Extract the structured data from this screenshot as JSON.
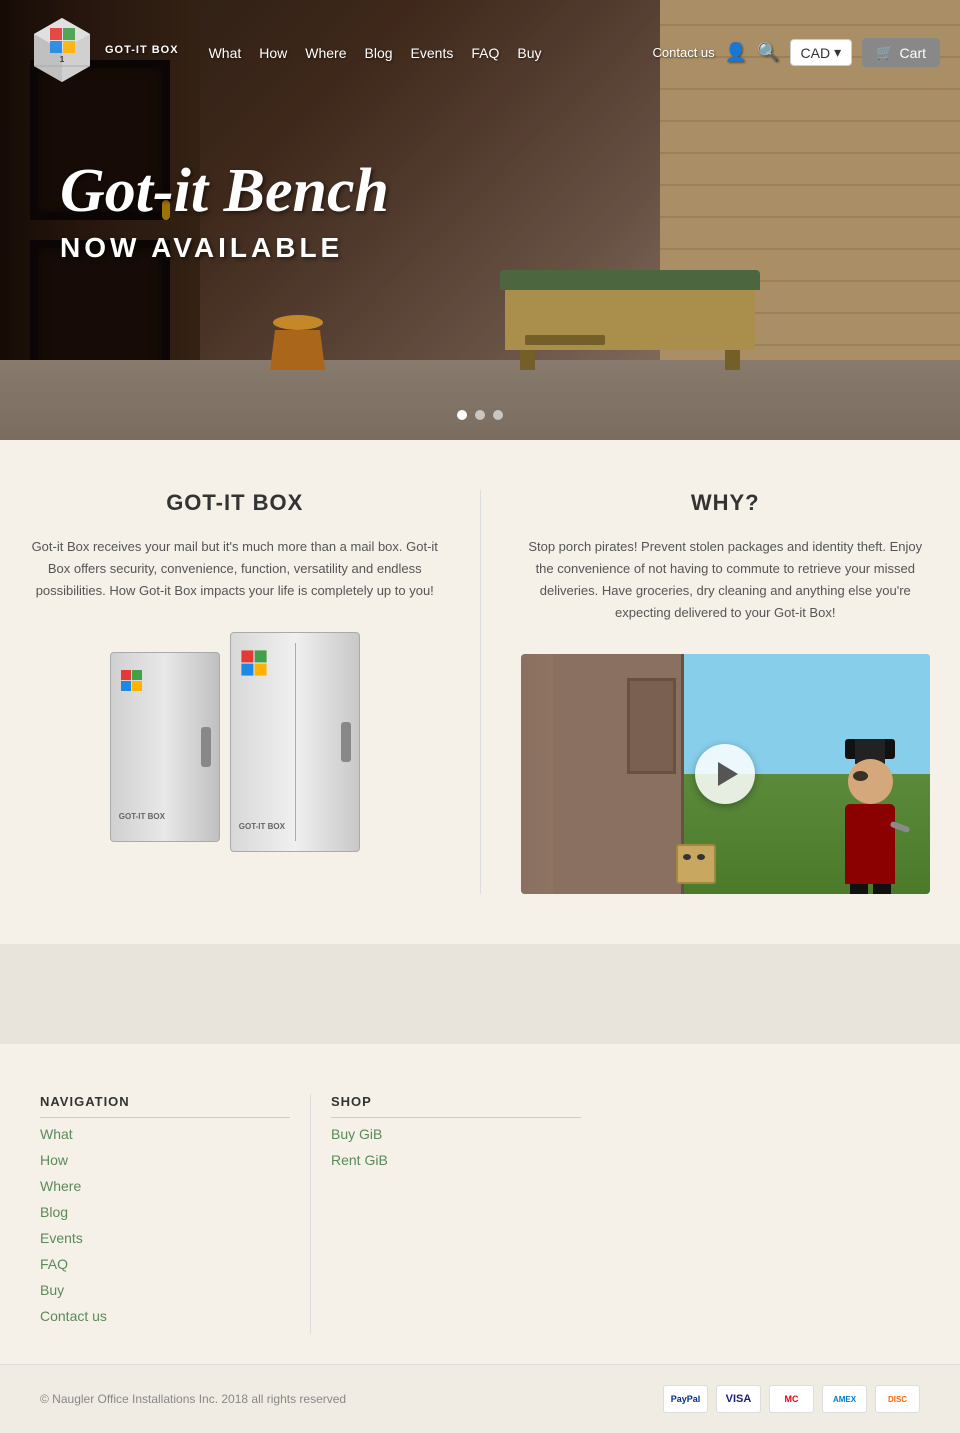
{
  "header": {
    "logo_alt": "Got-it Box Logo",
    "nav": {
      "items": [
        {
          "label": "What",
          "href": "#"
        },
        {
          "label": "How",
          "href": "#"
        },
        {
          "label": "Where",
          "href": "#"
        },
        {
          "label": "Blog",
          "href": "#"
        },
        {
          "label": "Events",
          "href": "#"
        },
        {
          "label": "FAQ",
          "href": "#"
        },
        {
          "label": "Buy",
          "href": "#"
        }
      ]
    },
    "contact_us": "Contact us",
    "cad_label": "CAD",
    "cart_label": "Cart"
  },
  "hero": {
    "title_script": "Got-it Bench",
    "subtitle": "NOW AVAILABLE",
    "dots": [
      {
        "active": true
      },
      {
        "active": false
      },
      {
        "active": false
      }
    ]
  },
  "main": {
    "left_col": {
      "title": "GOT-IT BOX",
      "text": "Got-it Box receives your mail but it's much more than a mail box. Got-it Box offers security, convenience, function, versatility and endless possibilities. How Got-it Box impacts your life is completely up to you!"
    },
    "right_col": {
      "title": "WHY?",
      "text": "Stop porch pirates! Prevent stolen packages and identity theft. Enjoy the convenience of not having to commute to retrieve your missed deliveries. Have groceries, dry cleaning and anything else you're expecting delivered to your Got-it Box!"
    }
  },
  "footer": {
    "navigation": {
      "title": "NAVIGATION",
      "items": [
        {
          "label": "What",
          "href": "#"
        },
        {
          "label": "How",
          "href": "#"
        },
        {
          "label": "Where",
          "href": "#"
        },
        {
          "label": "Blog",
          "href": "#"
        },
        {
          "label": "Events",
          "href": "#"
        },
        {
          "label": "FAQ",
          "href": "#"
        },
        {
          "label": "Buy",
          "href": "#"
        },
        {
          "label": "Contact us",
          "href": "#"
        }
      ]
    },
    "shop": {
      "title": "SHOP",
      "items": [
        {
          "label": "Buy GiB",
          "href": "#"
        },
        {
          "label": "Rent GiB",
          "href": "#"
        }
      ]
    },
    "copyright": "© Naugler Office Installations Inc. 2018 all rights reserved",
    "payment_methods": [
      {
        "label": "PayPal",
        "class": "paypal"
      },
      {
        "label": "VISA",
        "class": "visa"
      },
      {
        "label": "MC",
        "class": "mastercard"
      },
      {
        "label": "AMEX",
        "class": "amex"
      },
      {
        "label": "DISC",
        "class": "discover"
      }
    ]
  }
}
